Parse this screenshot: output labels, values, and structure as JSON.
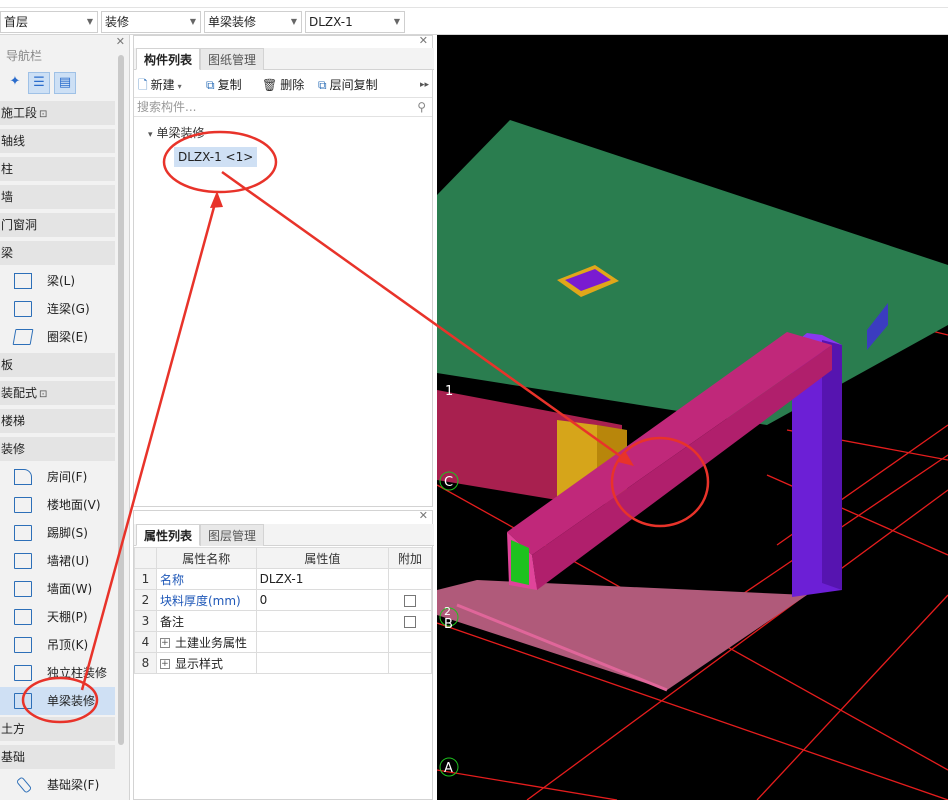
{
  "toolbar": {
    "floor": "首层",
    "type": "装修",
    "category": "单梁装修",
    "component": "DLZX-1"
  },
  "nav": {
    "title": "导航栏",
    "categories": [
      {
        "label": "施工段",
        "locked": true
      },
      {
        "label": "轴线"
      },
      {
        "label": "柱"
      },
      {
        "label": "墙"
      },
      {
        "label": "门窗洞"
      },
      {
        "label": "梁"
      },
      {
        "label": "板"
      },
      {
        "label": "装配式",
        "locked": true
      },
      {
        "label": "楼梯"
      },
      {
        "label": "装修"
      },
      {
        "label": "土方"
      },
      {
        "label": "基础"
      }
    ],
    "beam_items": [
      "梁(L)",
      "连梁(G)",
      "圈梁(E)"
    ],
    "deco_items": [
      "房间(F)",
      "楼地面(V)",
      "踢脚(S)",
      "墙裙(U)",
      "墙面(W)",
      "天棚(P)",
      "吊顶(K)",
      "独立柱装修",
      "单梁装修"
    ],
    "foundation_items": [
      "基础梁(F)"
    ],
    "lock_icon": "🔒"
  },
  "component_panel": {
    "tab_active": "构件列表",
    "tab_inactive": "图纸管理",
    "new_label": "新建",
    "copy_label": "复制",
    "delete_label": "删除",
    "floor_copy_label": "层间复制",
    "search_placeholder": "搜索构件...",
    "tree_parent": "单梁装修",
    "tree_child": "DLZX-1 <1>"
  },
  "property_panel": {
    "tab_active": "属性列表",
    "tab_inactive": "图层管理",
    "headers": [
      "属性名称",
      "属性值",
      "附加"
    ],
    "rows": [
      {
        "num": "1",
        "name": "名称",
        "value": "DLZX-1",
        "blue": true,
        "check": false
      },
      {
        "num": "2",
        "name": "块料厚度(mm)",
        "value": "0",
        "blue": true,
        "check": true
      },
      {
        "num": "3",
        "name": "备注",
        "value": "",
        "blue": false,
        "check": true
      },
      {
        "num": "4",
        "name": "土建业务属性",
        "value": "",
        "blue": false,
        "expand": true
      },
      {
        "num": "8",
        "name": "显示样式",
        "value": "",
        "blue": false,
        "expand": true
      }
    ]
  },
  "viewport": {
    "axis_labels": [
      "1",
      "C",
      "2",
      "B",
      "A"
    ],
    "colors": {
      "slab": "#2a7d4f",
      "beam": "#c0287a",
      "column": "#6c1fd6",
      "floor_patch": "#b05a7a",
      "annotation": "#e8332a",
      "grid": "#e51d1d"
    }
  }
}
